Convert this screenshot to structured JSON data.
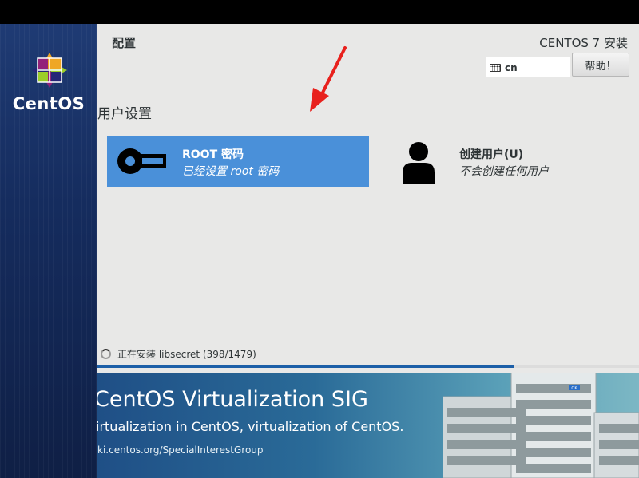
{
  "sidebar": {
    "brand": "CentOS"
  },
  "header": {
    "page_title": "配置",
    "product": "CENTOS 7 安装",
    "keyboard_layout": "cn",
    "help_label": "帮助！"
  },
  "main": {
    "section_title": "用户设置",
    "tiles": [
      {
        "name": "ROOT 密码",
        "status": "已经设置 root 密码",
        "icon": "key-icon",
        "selected": true
      },
      {
        "name": "创建用户(U)",
        "status": "不会创建任何用户",
        "icon": "user-icon",
        "selected": false
      }
    ]
  },
  "progress": {
    "text": "正在安装 libsecret (398/1479)",
    "fraction": 0.77
  },
  "banner": {
    "title": "CentOS Virtualization SIG",
    "subtitle": "irtualization in CentOS, virtualization of CentOS.",
    "url": "ki.centos.org/SpecialInterestGroup",
    "server_badge": "OK"
  },
  "colors": {
    "sidebar": "#1f3b74",
    "selected_tile": "#4a90d9",
    "progress": "#1d5fa8",
    "arrow": "#e8211d"
  }
}
